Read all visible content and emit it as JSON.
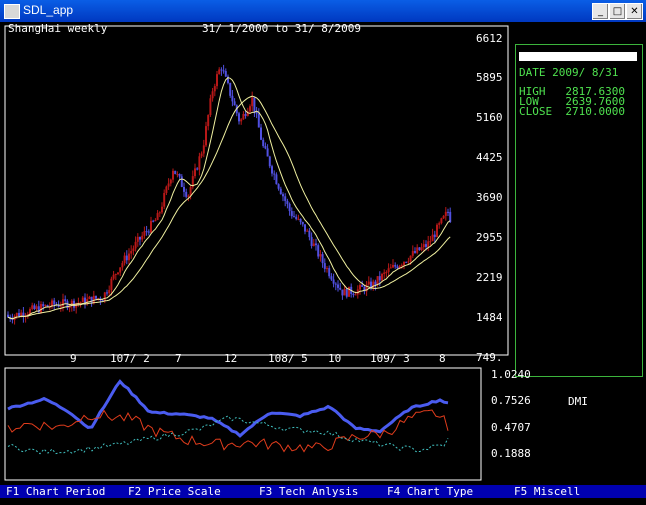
{
  "window": {
    "title": "SDL_app",
    "minimize_glyph": "_",
    "maximize_glyph": "□",
    "close_glyph": "✕"
  },
  "chart": {
    "name": "ShangHai weekly",
    "range": "31/ 1/2000 to 31/ 8/2009",
    "price_labels": [
      "6612",
      "5895",
      "5160",
      "4425",
      "3690",
      "2955",
      "2219",
      "1484",
      "749."
    ],
    "date_labels": [
      "9",
      "107/ 2",
      "7",
      "12",
      "108/ 5",
      "10",
      "109/ 3",
      "8"
    ]
  },
  "info": {
    "date_label": "DATE 2009/ 8/31",
    "high_label": "HIGH   2817.6300",
    "low_label": "LOW    2639.7600",
    "close_label": "CLOSE  2710.0000"
  },
  "indicator": {
    "name": "DMI",
    "scale_labels": [
      "1.0240",
      "0.7526",
      "0.4707",
      "0.1888"
    ]
  },
  "function_keys": [
    "F1 Chart Period",
    "F2 Price Scale",
    "F3 Tech Anlysis",
    "F4 Chart Type",
    "F5 Miscell"
  ],
  "colors": {
    "candle_up": "#b81818",
    "candle_down": "#5050e0",
    "moving_average": "#f0f0a0",
    "dmi_main": "#4a5cf0",
    "dmi_plus": "#e03c1c",
    "dmi_minus": "#40c0c0",
    "info_text": "#4fe24f",
    "function_bar": "#0000b0"
  }
}
